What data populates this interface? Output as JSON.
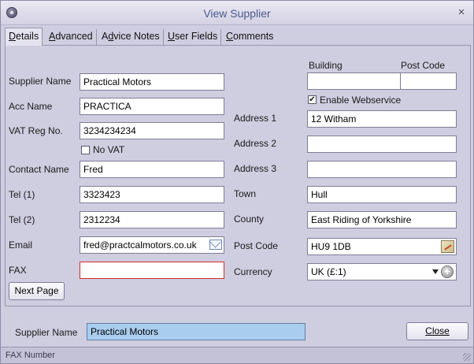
{
  "window": {
    "title": "View Supplier",
    "close_glyph": "×"
  },
  "tabs": [
    {
      "pre": "",
      "u": "D",
      "post": "etails"
    },
    {
      "pre": "",
      "u": "A",
      "post": "dvanced"
    },
    {
      "pre": "A",
      "u": "d",
      "post": "vice Notes"
    },
    {
      "pre": "",
      "u": "U",
      "post": "ser Fields"
    },
    {
      "pre": "",
      "u": "C",
      "post": "omments"
    }
  ],
  "left": {
    "supplier_name": {
      "label": "Supplier Name",
      "value": "Practical Motors"
    },
    "acc_name": {
      "label": "Acc Name",
      "value": "PRACTICA"
    },
    "vat_reg": {
      "label": "VAT Reg No.",
      "value": "3234234234"
    },
    "no_vat": {
      "label": "No VAT",
      "checked": false
    },
    "contact_name": {
      "label": "Contact Name",
      "value": "Fred"
    },
    "tel1": {
      "label": "Tel (1)",
      "value": "3323423"
    },
    "tel2": {
      "label": "Tel (2)",
      "value": "2312234"
    },
    "email": {
      "label": "Email",
      "value": "fred@practcalmotors.co.uk",
      "icon": "envelope-icon"
    },
    "fax": {
      "label": "FAX",
      "value": ""
    },
    "next_page": {
      "label": "Next Page"
    }
  },
  "right": {
    "building": {
      "label": "Building",
      "value": ""
    },
    "post_code_top": {
      "label": "Post Code",
      "value": ""
    },
    "enable_webservice": {
      "label": "Enable Webservice",
      "checked": true,
      "glyph": "✔"
    },
    "address1": {
      "label": "Address 1",
      "value": "12 Witham"
    },
    "address2": {
      "label": "Address 2",
      "value": ""
    },
    "address3": {
      "label": "Address 3",
      "value": ""
    },
    "town": {
      "label": "Town",
      "value": "Hull"
    },
    "county": {
      "label": "County",
      "value": "East Riding of Yorkshire"
    },
    "post_code": {
      "label": "Post Code",
      "value": "HU9 1DB",
      "icon": "map-icon"
    },
    "currency": {
      "label": "Currency",
      "value": "UK (£:1)",
      "add_glyph": "+"
    }
  },
  "footer": {
    "supplier_label": "Supplier Name",
    "supplier_value": "Practical Motors",
    "close_label": "Close"
  },
  "status": {
    "text": "FAX Number"
  },
  "colors": {
    "window_bg": "#cfcde0",
    "title": "#4a5a8a",
    "highlight": "#a9cdef",
    "error_border": "#d22c2c"
  }
}
